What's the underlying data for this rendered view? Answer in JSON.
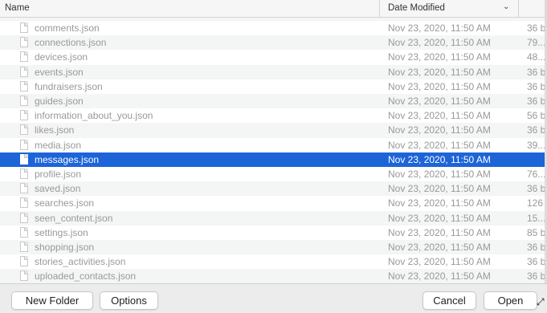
{
  "header": {
    "name_label": "Name",
    "date_label": "Date Modified",
    "sort_icon": "chevron-down-icon"
  },
  "files": [
    {
      "name": "comments.json",
      "date": "Nov 23, 2020, 11:50 AM",
      "size": "36 b"
    },
    {
      "name": "connections.json",
      "date": "Nov 23, 2020, 11:50 AM",
      "size": "79..."
    },
    {
      "name": "devices.json",
      "date": "Nov 23, 2020, 11:50 AM",
      "size": "48..."
    },
    {
      "name": "events.json",
      "date": "Nov 23, 2020, 11:50 AM",
      "size": "36 b"
    },
    {
      "name": "fundraisers.json",
      "date": "Nov 23, 2020, 11:50 AM",
      "size": "36 b"
    },
    {
      "name": "guides.json",
      "date": "Nov 23, 2020, 11:50 AM",
      "size": "36 b"
    },
    {
      "name": "information_about_you.json",
      "date": "Nov 23, 2020, 11:50 AM",
      "size": "56 b"
    },
    {
      "name": "likes.json",
      "date": "Nov 23, 2020, 11:50 AM",
      "size": "36 b"
    },
    {
      "name": "media.json",
      "date": "Nov 23, 2020, 11:50 AM",
      "size": "39..."
    },
    {
      "name": "messages.json",
      "date": "Nov 23, 2020, 11:50 AM",
      "size": "",
      "selected": true
    },
    {
      "name": "profile.json",
      "date": "Nov 23, 2020, 11:50 AM",
      "size": "76..."
    },
    {
      "name": "saved.json",
      "date": "Nov 23, 2020, 11:50 AM",
      "size": "36 b"
    },
    {
      "name": "searches.json",
      "date": "Nov 23, 2020, 11:50 AM",
      "size": "126"
    },
    {
      "name": "seen_content.json",
      "date": "Nov 23, 2020, 11:50 AM",
      "size": "15..."
    },
    {
      "name": "settings.json",
      "date": "Nov 23, 2020, 11:50 AM",
      "size": "85 b"
    },
    {
      "name": "shopping.json",
      "date": "Nov 23, 2020, 11:50 AM",
      "size": "36 b"
    },
    {
      "name": "stories_activities.json",
      "date": "Nov 23, 2020, 11:50 AM",
      "size": "36 b"
    },
    {
      "name": "uploaded_contacts.json",
      "date": "Nov 23, 2020, 11:50 AM",
      "size": "36 b"
    }
  ],
  "footer": {
    "new_folder_label": "New Folder",
    "options_label": "Options",
    "cancel_label": "Cancel",
    "open_label": "Open"
  },
  "colors": {
    "selection": "#1d64d8",
    "row_alt": "#f4f5f5",
    "muted_text": "#999999"
  }
}
